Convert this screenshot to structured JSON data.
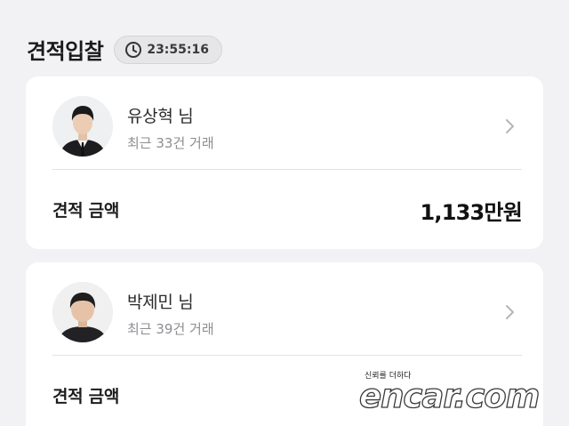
{
  "header": {
    "title": "견적입찰",
    "timer": "23:55:16",
    "timer_icon": "clock-icon"
  },
  "bids": [
    {
      "dealer_name": "유상혁 님",
      "recent_trades": "최근 33건 거래",
      "amount_label": "견적 금액",
      "amount_value": "1,133만원"
    },
    {
      "dealer_name": "박제민 님",
      "recent_trades": "최근 39건 거래",
      "amount_label": "견적 금액",
      "amount_value": ""
    }
  ],
  "watermark": {
    "slogan": "신뢰를 더하다",
    "logo": "encar.com"
  },
  "colors": {
    "background": "#f2f2f4",
    "card": "#ffffff",
    "badge_bg": "#e6e6e9",
    "muted_text": "#8e8e93"
  }
}
